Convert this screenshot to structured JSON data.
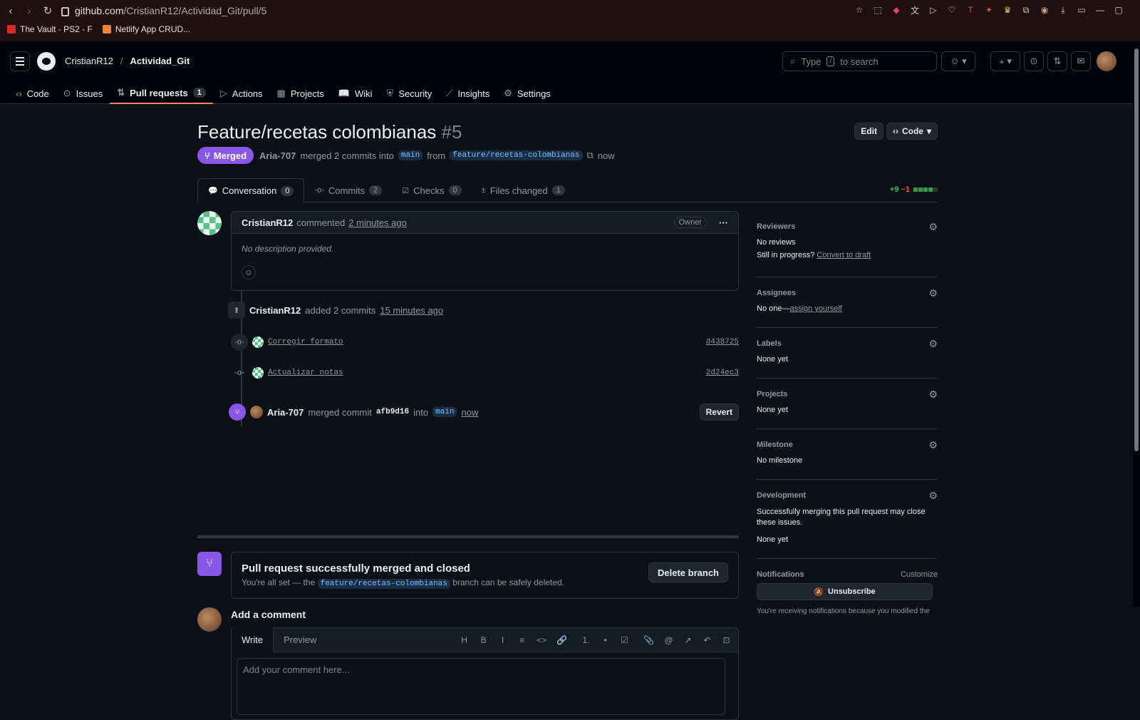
{
  "browser": {
    "url_host": "github.com",
    "url_path": "/CristianR12/Actividad_Git/pull/5",
    "bookmarks": [
      {
        "label": "The Vault - PS2 - F",
        "color": "#d82a2a"
      },
      {
        "label": "Netlify App CRUD...",
        "color": "#f0823c"
      }
    ],
    "ext_icons": [
      "bookmark-icon",
      "screenshot-icon",
      "pocket-icon",
      "translate-icon",
      "play-icon",
      "heart-icon",
      "tp-icon",
      "extension-icon",
      "crown-icon",
      "puzzle-icon",
      "profile-icon",
      "download-icon",
      "window-icon",
      "minimize-icon",
      "maximize-icon"
    ]
  },
  "header": {
    "owner": "CristianR12",
    "separator": "/",
    "repo": "Actividad_Git",
    "search_label": "Type",
    "search_key": "/",
    "search_suffix": "to search",
    "plus": "+",
    "tabs": [
      {
        "label": "Code",
        "icon": "code-icon"
      },
      {
        "label": "Issues",
        "icon": "issue-icon"
      },
      {
        "label": "Pull requests",
        "icon": "pr-icon",
        "count": "1",
        "selected": true
      },
      {
        "label": "Actions",
        "icon": "play-icon"
      },
      {
        "label": "Projects",
        "icon": "table-icon"
      },
      {
        "label": "Wiki",
        "icon": "book-icon"
      },
      {
        "label": "Security",
        "icon": "shield-icon"
      },
      {
        "label": "Insights",
        "icon": "graph-icon"
      },
      {
        "label": "Settings",
        "icon": "gear-icon"
      }
    ]
  },
  "pr": {
    "title": "Feature/recetas colombianas",
    "number": "#5",
    "edit_label": "Edit",
    "code_label": "Code",
    "state": "Merged",
    "author": "Aria-707",
    "merge_text": "merged 2 commits into",
    "base": "main",
    "from_text": "from",
    "head": "feature/recetas-colombianas",
    "time": "now",
    "tabs": [
      {
        "label": "Conversation",
        "count": "0",
        "selected": true
      },
      {
        "label": "Commits",
        "count": "2"
      },
      {
        "label": "Checks",
        "count": "0"
      },
      {
        "label": "Files changed",
        "count": "1"
      }
    ],
    "additions": "+9",
    "deletions": "−1",
    "diff_blocks": {
      "added": 4,
      "removed": 0,
      "neutral": 1
    }
  },
  "timeline": {
    "comment": {
      "author": "CristianR12",
      "action": "commented",
      "time": "2 minutes ago",
      "owner_badge": "Owner",
      "menu": "···",
      "body": "No description provided."
    },
    "added": {
      "author": "CristianR12",
      "action": "added 2 commits",
      "time": "15 minutes ago"
    },
    "commits": [
      {
        "message": "Corregir formato",
        "sha": "d438725"
      },
      {
        "message": "Actualizar notas",
        "sha": "2d24ec3"
      }
    ],
    "merge": {
      "author": "Aria-707",
      "action": "merged commit",
      "sha": "afb9d16",
      "into": "into",
      "base": "main",
      "time": "now",
      "revert_label": "Revert"
    },
    "merged_box": {
      "title": "Pull request successfully merged and closed",
      "text_before": "You're all set — the",
      "branch": "feature/recetas-colombianas",
      "text_after": "branch can be safely deleted.",
      "delete_label": "Delete branch"
    },
    "add_comment": {
      "title": "Add a comment",
      "write_tab": "Write",
      "preview_tab": "Preview",
      "placeholder": "Add your comment here...",
      "tools": [
        "H",
        "B",
        "I",
        "≡",
        "<>",
        "🔗",
        "1.",
        "•",
        "☑",
        "📎",
        "@",
        "↗",
        "↶",
        "⊡"
      ]
    }
  },
  "sidebar": {
    "reviewers": {
      "label": "Reviewers",
      "value": "No reviews",
      "progress": "Still in progress?",
      "draft_link": "Convert to draft"
    },
    "assignees": {
      "label": "Assignees",
      "value": "No one—",
      "link": "assign yourself"
    },
    "labels": {
      "label": "Labels",
      "value": "None yet"
    },
    "projects": {
      "label": "Projects",
      "value": "None yet"
    },
    "milestone": {
      "label": "Milestone",
      "value": "No milestone"
    },
    "development": {
      "label": "Development",
      "desc": "Successfully merging this pull request may close these issues.",
      "value": "None yet"
    },
    "notifications": {
      "label": "Notifications",
      "customize": "Customize",
      "unsubscribe": "Unsubscribe",
      "reason": "You're receiving notifications because you modified the"
    }
  }
}
